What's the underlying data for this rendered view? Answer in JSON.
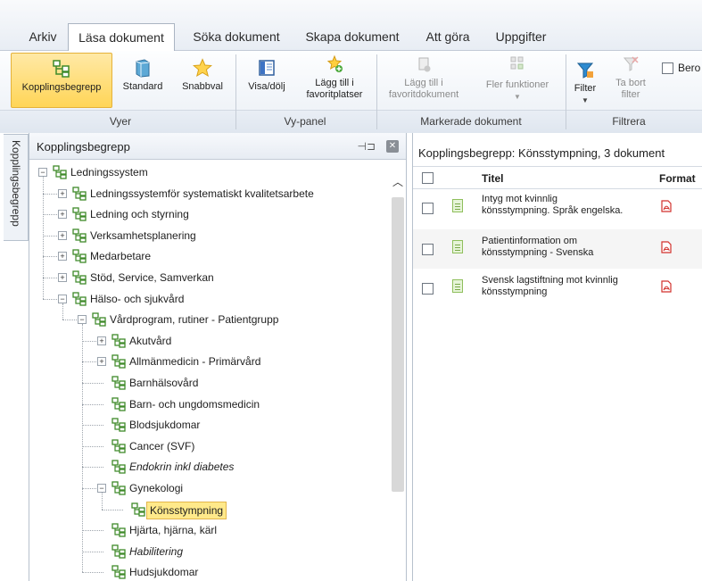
{
  "menu_tabs": [
    "Arkiv",
    "Läsa dokument",
    "Söka dokument",
    "Skapa dokument",
    "Att göra",
    "Uppgifter"
  ],
  "ribbon": {
    "buttons": [
      {
        "label": "Kopplingsbegrepp",
        "icon": "link-tree-icon"
      },
      {
        "label": "Standard",
        "icon": "book-icon"
      },
      {
        "label": "Snabbval",
        "icon": "star-icon"
      },
      {
        "label": "Visa/dölj",
        "icon": "panel-icon"
      },
      {
        "label": "Lägg till i",
        "label2": "favoritplatser",
        "icon": "favorite-add-icon"
      },
      {
        "label": "Lägg till i",
        "label2": "favoritdokument",
        "icon": "favorite-doc-icon"
      },
      {
        "label": "Fler funktioner",
        "icon": "grid-icon"
      },
      {
        "label": "Filter",
        "icon": "filter-icon"
      },
      {
        "label": "Ta bort",
        "label2": "filter",
        "icon": "remove-filter-icon"
      }
    ],
    "checkbox_label": "Bero",
    "groups": [
      "Vyer",
      "Vy-panel",
      "Markerade dokument",
      "Filtrera"
    ]
  },
  "side_tab": "Kopplingsbegrepp",
  "tree_pane": {
    "title": "Kopplingsbegrepp",
    "nodes": [
      "Ledningssystem",
      "Ledningssystemför systematiskt kvalitetsarbete",
      "Ledning och styrning",
      "Verksamhetsplanering",
      "Medarbetare",
      "Stöd, Service, Samverkan",
      "Hälso- och sjukvård",
      "Vårdprogram, rutiner - Patientgrupp",
      "Akutvård",
      "Allmänmedicin - Primärvård",
      "Barnhälsovård",
      "Barn- och ungdomsmedicin",
      "Blodsjukdomar",
      "Cancer (SVF)",
      "Endokrin inkl diabetes",
      "Gynekologi",
      "Könsstympning",
      "Hjärta, hjärna, kärl",
      "Habilitering",
      "Hudsjukdomar"
    ]
  },
  "doc_pane": {
    "header": "Kopplingsbegrepp: Könsstympning, 3 dokument",
    "col_title": "Titel",
    "col_format": "Format",
    "docs": [
      {
        "line1": "Intyg mot kvinnlig",
        "line2": "könsstympning. Språk engelska."
      },
      {
        "line1": "Patientinformation om",
        "line2": "könsstympning - Svenska"
      },
      {
        "line1": "Svensk lagstiftning mot kvinnlig",
        "line2": "könsstympning"
      }
    ]
  },
  "colors": {
    "selected_ribbon": "#ffd557",
    "highlight": "#ffe98a",
    "tree_icon": "#4a8f2a",
    "pdf_icon": "#d2322d"
  }
}
